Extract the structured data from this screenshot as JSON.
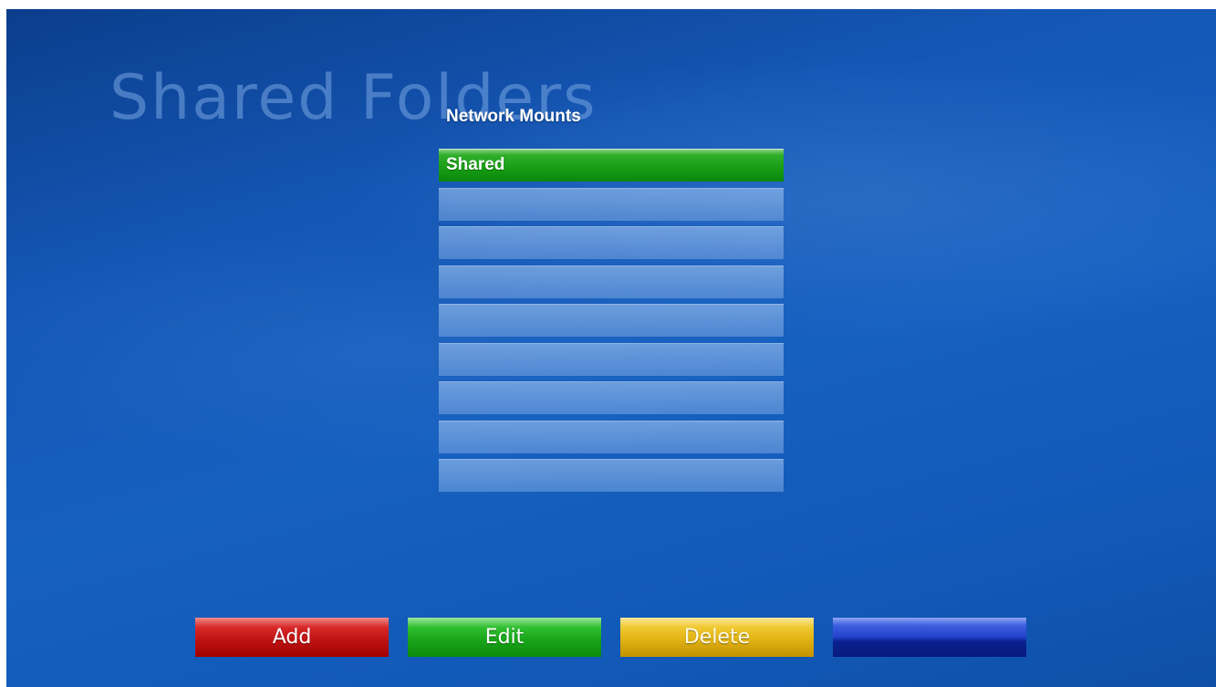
{
  "screen": {
    "background_title": "Shared Folders",
    "panel_title": "Network Mounts"
  },
  "mounts": {
    "items": [
      {
        "label": "Shared",
        "selected": true
      },
      {
        "label": "",
        "selected": false
      },
      {
        "label": "",
        "selected": false
      },
      {
        "label": "",
        "selected": false
      },
      {
        "label": "",
        "selected": false
      },
      {
        "label": "",
        "selected": false
      },
      {
        "label": "",
        "selected": false
      },
      {
        "label": "",
        "selected": false
      },
      {
        "label": "",
        "selected": false
      }
    ]
  },
  "buttons": {
    "add": "Add",
    "edit": "Edit",
    "delete": "Delete",
    "blue": ""
  },
  "colors": {
    "background": "#1660c0",
    "selected_row": "#179d14",
    "add_button": "#c01414",
    "edit_button": "#1aa61a",
    "delete_button": "#e2b314",
    "blue_button": "#2340c8"
  }
}
